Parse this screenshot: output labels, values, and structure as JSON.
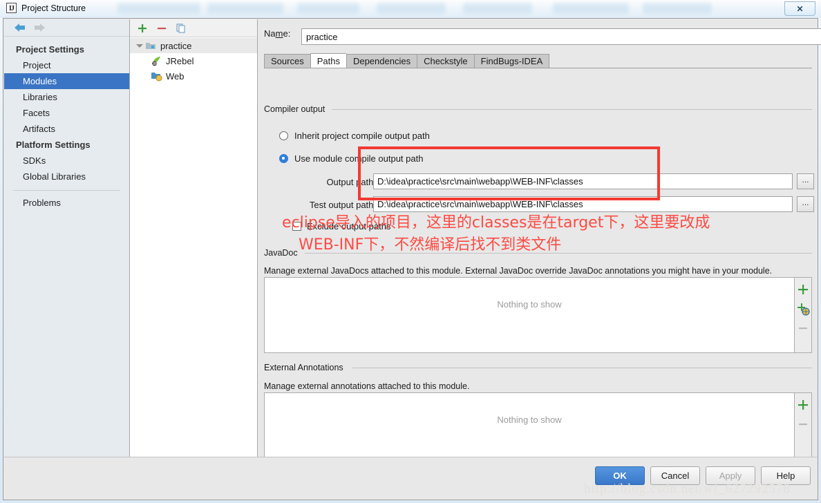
{
  "window": {
    "title": "Project Structure",
    "app_icon": "idea-icon",
    "close_label": "✕"
  },
  "sidebar": {
    "nav": {
      "back": "back-arrow",
      "forward": "forward-arrow"
    },
    "sections": [
      {
        "group": "Project Settings",
        "items": [
          {
            "label": "Project",
            "selected": false
          },
          {
            "label": "Modules",
            "selected": true
          },
          {
            "label": "Libraries",
            "selected": false
          },
          {
            "label": "Facets",
            "selected": false
          },
          {
            "label": "Artifacts",
            "selected": false
          }
        ]
      },
      {
        "group": "Platform Settings",
        "items": [
          {
            "label": "SDKs",
            "selected": false
          },
          {
            "label": "Global Libraries",
            "selected": false
          }
        ]
      }
    ],
    "problems": "Problems"
  },
  "tree": {
    "toolbar": [
      {
        "name": "add-module-button",
        "glyph": "+"
      },
      {
        "name": "remove-module-button",
        "glyph": "−"
      },
      {
        "name": "copy-module-button",
        "glyph": "copy"
      }
    ],
    "rows": [
      {
        "label": "practice",
        "icon": "module-icon",
        "level": 0,
        "expanded": true
      },
      {
        "label": "JRebel",
        "icon": "jrebel-icon",
        "level": 1
      },
      {
        "label": "Web",
        "icon": "web-facet-icon",
        "level": 1
      }
    ]
  },
  "main": {
    "name_label": "Name:",
    "name_value": "practice",
    "tabs": [
      {
        "label": "Sources",
        "active": false
      },
      {
        "label": "Paths",
        "active": true
      },
      {
        "label": "Dependencies",
        "active": false
      },
      {
        "label": "Checkstyle",
        "active": false
      },
      {
        "label": "FindBugs-IDEA",
        "active": false
      }
    ],
    "compiler_output": {
      "group_label": "Compiler output",
      "radios": [
        {
          "label": "Inherit project compile output path",
          "selected": false
        },
        {
          "label": "Use module compile output path",
          "selected": true
        }
      ],
      "output_path": {
        "label": "Output path:",
        "value": "D:\\idea\\practice\\src\\main\\webapp\\WEB-INF\\classes",
        "browse": "..."
      },
      "test_output_path": {
        "label": "Test output path:",
        "value": "D:\\idea\\practice\\src\\main\\webapp\\WEB-INF\\classes",
        "browse": "..."
      },
      "exclude_checkbox": {
        "label": "Exclude output paths",
        "checked": false
      }
    },
    "javadoc": {
      "group_label": "JavaDoc",
      "description": "Manage external JavaDocs attached to this module. External JavaDoc override JavaDoc annotations you might have in your module.",
      "empty_text": "Nothing to show",
      "actions": [
        {
          "name": "add-javadoc-button",
          "glyph": "+"
        },
        {
          "name": "add-javadoc-url-button",
          "glyph": "+url"
        },
        {
          "name": "remove-javadoc-button",
          "glyph": "−"
        }
      ]
    },
    "external_annotations": {
      "group_label": "External Annotations",
      "description": "Manage external annotations attached to this module.",
      "empty_text": "Nothing to show",
      "actions": [
        {
          "name": "add-annotation-button",
          "glyph": "+"
        },
        {
          "name": "remove-annotation-button",
          "glyph": "−"
        }
      ]
    }
  },
  "annotation": {
    "line1": "eclipse导入的项目，这里的classes是在target下，这里要改成",
    "line2": "WEB-INF下，不然编译后找不到类文件",
    "color": "#fc4b43"
  },
  "buttons": {
    "ok": "OK",
    "cancel": "Cancel",
    "apply": "Apply",
    "help": "Help"
  },
  "watermark": "http://blog.csdn.net/wl_627292578",
  "colors": {
    "accent": "#3a74c4",
    "annotation_red": "#fc4b43",
    "dialog_bg": "#e8e8e8",
    "sidebar_bg": "#e5ebef"
  }
}
